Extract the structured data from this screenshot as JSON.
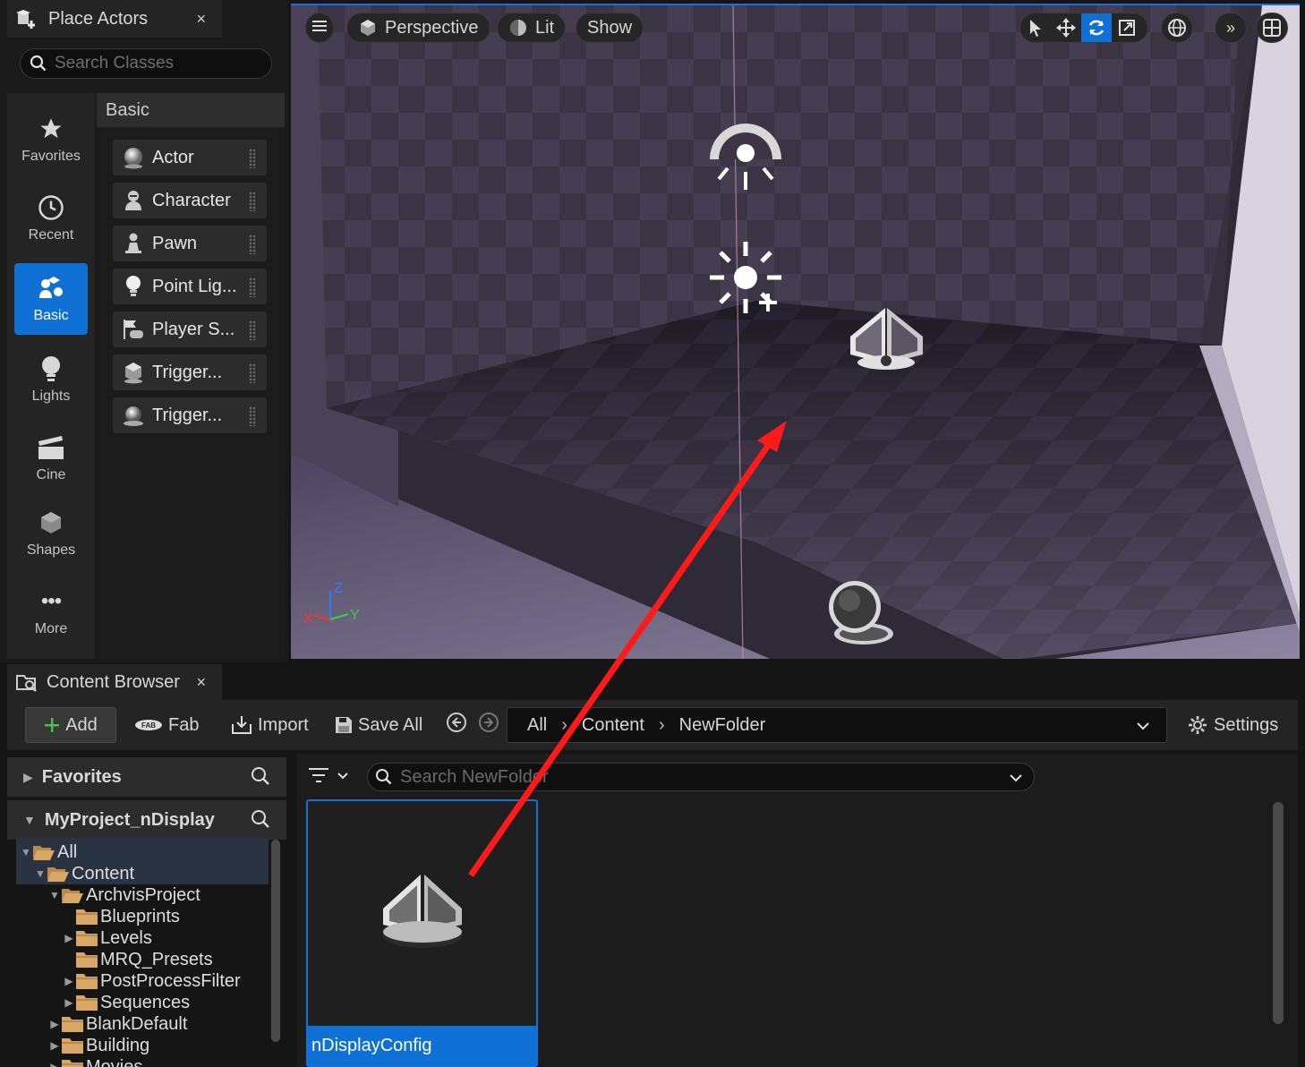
{
  "place_actors": {
    "tab_title": "Place Actors",
    "close_glyph": "×",
    "search_placeholder": "Search Classes",
    "categories": [
      {
        "label": "Favorites",
        "icon": "star-icon"
      },
      {
        "label": "Recent",
        "icon": "clock-icon"
      },
      {
        "label": "Basic",
        "icon": "shapes-person-icon",
        "active": true
      },
      {
        "label": "Lights",
        "icon": "bulb-icon"
      },
      {
        "label": "Cine",
        "icon": "clapper-icon"
      },
      {
        "label": "Shapes",
        "icon": "cube-icon"
      },
      {
        "label": "More",
        "icon": "ellipsis-icon"
      }
    ],
    "list_header": "Basic",
    "items": [
      {
        "label": "Actor",
        "icon": "actor-sphere-icon"
      },
      {
        "label": "Character",
        "icon": "character-icon"
      },
      {
        "label": "Pawn",
        "icon": "pawn-icon"
      },
      {
        "label": "Point Lig...",
        "icon": "point-light-icon"
      },
      {
        "label": "Player S...",
        "icon": "player-start-icon"
      },
      {
        "label": "Trigger...",
        "icon": "trigger-box-icon"
      },
      {
        "label": "Trigger...",
        "icon": "trigger-sphere-icon"
      }
    ]
  },
  "viewport": {
    "menu_icon": "hamburger-icon",
    "perspective_label": "Perspective",
    "lit_label": "Lit",
    "show_label": "Show",
    "tools": [
      "select-arrow-icon",
      "move-icon",
      "rotate-icon",
      "scale-icon"
    ],
    "world_icon": "globe-icon",
    "more_icon": "double-chevron-icon",
    "layout_icon": "grid-layout-icon",
    "axis": {
      "z": "Z",
      "x": "X",
      "y": "Y"
    },
    "colors": {
      "accent": "#0f70d6",
      "arrow": "#ff1a1a"
    }
  },
  "content_browser": {
    "tab_title": "Content Browser",
    "close_glyph": "×",
    "toolbar": {
      "add_label": "Add",
      "fab_label": "Fab",
      "import_label": "Import",
      "save_all_label": "Save All",
      "settings_label": "Settings"
    },
    "path": [
      "All",
      "Content",
      "NewFolder"
    ],
    "favorites_label": "Favorites",
    "project_label": "MyProject_nDisplay",
    "tree": [
      {
        "label": "All",
        "depth": 0,
        "caret": "▼"
      },
      {
        "label": "Content",
        "depth": 1,
        "caret": "▼"
      },
      {
        "label": "ArchvisProject",
        "depth": 2,
        "caret": "▼"
      },
      {
        "label": "Blueprints",
        "depth": 3,
        "caret": ""
      },
      {
        "label": "Levels",
        "depth": 3,
        "caret": "▶"
      },
      {
        "label": "MRQ_Presets",
        "depth": 3,
        "caret": ""
      },
      {
        "label": "PostProcessFilter",
        "depth": 3,
        "caret": "▶"
      },
      {
        "label": "Sequences",
        "depth": 3,
        "caret": "▶"
      },
      {
        "label": "BlankDefault",
        "depth": 2,
        "caret": "▶"
      },
      {
        "label": "Building",
        "depth": 2,
        "caret": "▶"
      },
      {
        "label": "Movies",
        "depth": 2,
        "caret": "▶"
      }
    ],
    "asset_search_placeholder": "Search NewFolder",
    "assets": [
      {
        "label": "nDisplayConfig",
        "icon": "ndisplay-config-icon"
      }
    ]
  }
}
